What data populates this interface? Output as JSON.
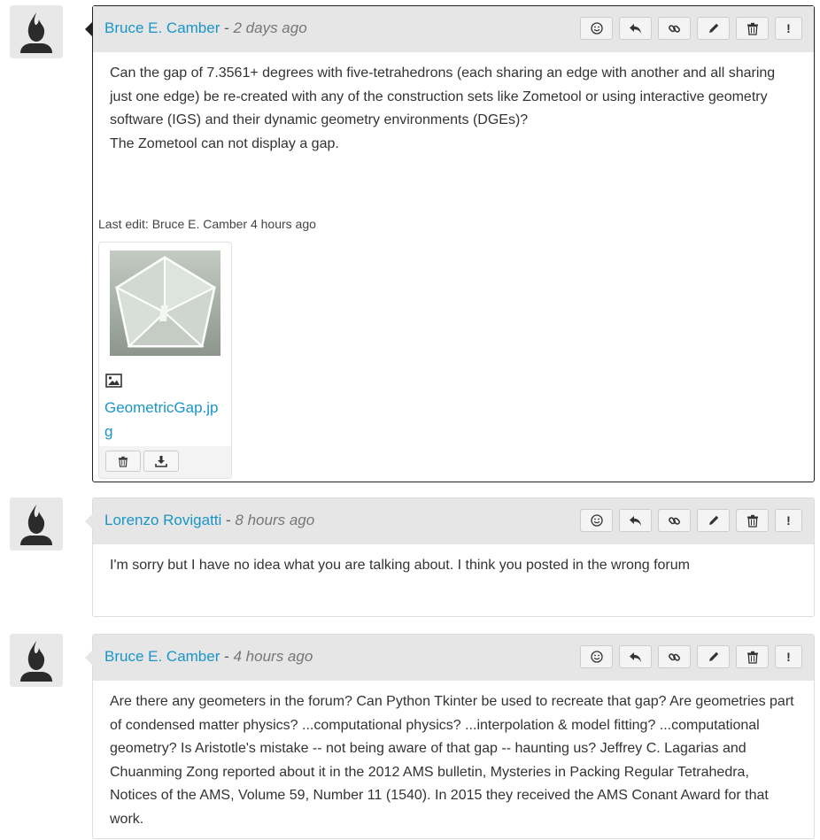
{
  "posts": [
    {
      "author": "Bruce E. Camber",
      "separator": " - ",
      "time": "2 days ago",
      "body": [
        "Can the gap of 7.3561+ degrees with five-tetrahedrons (each sharing an edge with another and all sharing just one edge) be re-created with any of the construction sets like Zometool or using interactive geometry software (IGS) and their dynamic geometry environments (DGEs)?",
        "The Zometool can not display a gap."
      ],
      "last_edit": "Last edit: Bruce E. Camber 4 hours ago",
      "attachment": {
        "file_name": "GeometricGap.jpg"
      }
    },
    {
      "author": "Lorenzo Rovigatti",
      "separator": " - ",
      "time": "8 hours ago",
      "body": [
        "I'm sorry but I have no idea what you are talking about. I think you posted in the wrong forum"
      ]
    },
    {
      "author": "Bruce E. Camber",
      "separator": " - ",
      "time": "4 hours ago",
      "body": [
        "Are there any geometers in the forum? Can Python Tkinter be used to recreate that gap? Are geometries part of condensed matter physics? ...computational physics? ...interpolation & model fitting? ...computational geometry? Is Aristotle's mistake -- not being aware of that gap -- haunting us? Jeffrey C. Lagarias and Chuanming Zong reported about it in the 2012 AMS bulletin, Mysteries in Packing Regular Tetrahedra, Notices of the AMS, Volume 59, Number 11 (1540). In 2015 they received the AMS Conant Award for that work."
      ]
    }
  ],
  "action_icons": [
    "smiley-icon",
    "reply-icon",
    "link-icon",
    "pencil-icon",
    "trash-icon",
    "exclamation-icon"
  ],
  "action_exclamation": "!",
  "colors": {
    "link": "#1a95c9",
    "header_bg": "#e6e6e6",
    "active_border": "#222222"
  }
}
